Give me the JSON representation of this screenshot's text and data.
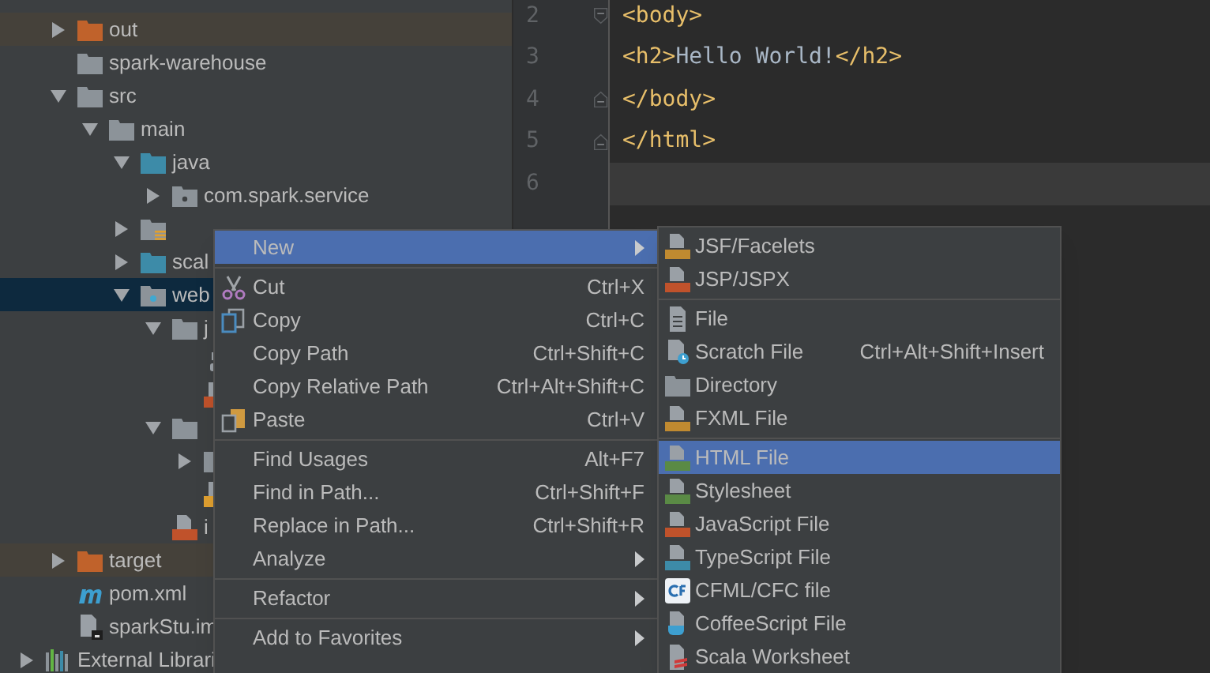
{
  "project_tree": [
    {
      "name": "out",
      "kind": "folder-excluded",
      "expanded": false,
      "selected": false
    },
    {
      "name": "spark-warehouse",
      "kind": "folder",
      "selected": false
    },
    {
      "name": "src",
      "kind": "folder",
      "expanded": true,
      "selected": false,
      "children": [
        {
          "name": "main",
          "kind": "folder",
          "expanded": true,
          "selected": false,
          "children": [
            {
              "name": "java",
              "kind": "folder-source",
              "expanded": true,
              "selected": false,
              "children": [
                {
                  "name": "com.spark.service",
                  "kind": "package",
                  "expanded": false,
                  "selected": false
                }
              ]
            },
            {
              "kind": "folder-resources",
              "expanded": false,
              "selected": false
            },
            {
              "name": "scal",
              "kind": "folder-source",
              "expanded": false,
              "selected": false
            },
            {
              "name": "web",
              "kind": "folder-web",
              "expanded": true,
              "selected": true,
              "children": [
                {
                  "name": "j",
                  "kind": "folder",
                  "expanded": true,
                  "selected": false,
                  "children": [
                    {
                      "kind": "file-binary",
                      "selected": false
                    },
                    {
                      "kind": "file-jsp",
                      "selected": false
                    }
                  ]
                },
                {
                  "kind": "folder",
                  "expanded": true,
                  "selected": false,
                  "children": [
                    {
                      "kind": "folder",
                      "expanded": false,
                      "selected": false
                    },
                    {
                      "kind": "file-xml",
                      "selected": false
                    }
                  ]
                },
                {
                  "name": "i",
                  "kind": "file-jsp",
                  "selected": false
                }
              ]
            }
          ]
        }
      ]
    },
    {
      "name": "target",
      "kind": "folder-excluded",
      "expanded": false,
      "selected": false
    },
    {
      "name": "pom.xml",
      "kind": "file-maven",
      "selected": false
    },
    {
      "name": "sparkStu.im",
      "kind": "file-iml",
      "selected": false
    }
  ],
  "external_libraries": {
    "name": "External Librari",
    "kind": "libraries",
    "expanded": false,
    "selected": false
  },
  "editor": {
    "lines": [
      {
        "number": "2",
        "current": false,
        "tokens": [
          {
            "kind": "tag",
            "text": "<body>"
          }
        ]
      },
      {
        "number": "3",
        "current": false,
        "tokens": [
          {
            "kind": "tag",
            "text": "<h2>"
          },
          {
            "kind": "text",
            "text": "Hello World!"
          },
          {
            "kind": "tag",
            "text": "</h2>"
          }
        ]
      },
      {
        "number": "4",
        "current": false,
        "tokens": [
          {
            "kind": "tag",
            "text": "</body>"
          }
        ]
      },
      {
        "number": "5",
        "current": false,
        "tokens": [
          {
            "kind": "tag",
            "text": "</html>"
          }
        ]
      },
      {
        "number": "6",
        "current": true
      }
    ]
  },
  "context_menu": [
    {
      "kind": "item",
      "label": "New",
      "submenu": true,
      "selected": true
    },
    {
      "kind": "separator"
    },
    {
      "kind": "item",
      "label": "Cut",
      "shortcut": "Ctrl+X",
      "submenu": false,
      "selected": false
    },
    {
      "kind": "item",
      "label": "Copy",
      "shortcut": "Ctrl+C",
      "submenu": false,
      "selected": false
    },
    {
      "kind": "item",
      "label": "Copy Path",
      "shortcut": "Ctrl+Shift+C",
      "submenu": false,
      "selected": false
    },
    {
      "kind": "item",
      "label": "Copy Relative Path",
      "shortcut": "Ctrl+Alt+Shift+C",
      "submenu": false,
      "selected": false
    },
    {
      "kind": "item",
      "label": "Paste",
      "shortcut": "Ctrl+V",
      "submenu": false,
      "selected": false
    },
    {
      "kind": "separator"
    },
    {
      "kind": "item",
      "label": "Find Usages",
      "shortcut": "Alt+F7",
      "submenu": false,
      "selected": false
    },
    {
      "kind": "item",
      "label": "Find in Path...",
      "shortcut": "Ctrl+Shift+F",
      "submenu": false,
      "selected": false
    },
    {
      "kind": "item",
      "label": "Replace in Path...",
      "shortcut": "Ctrl+Shift+R",
      "submenu": false,
      "selected": false
    },
    {
      "kind": "item",
      "label": "Analyze",
      "submenu": true,
      "selected": false
    },
    {
      "kind": "separator"
    },
    {
      "kind": "item",
      "label": "Refactor",
      "submenu": true,
      "selected": false
    },
    {
      "kind": "separator"
    },
    {
      "kind": "item",
      "label": "Add to Favorites",
      "submenu": true,
      "selected": false
    }
  ],
  "submenu": [
    {
      "kind": "item",
      "label": "JSF/Facelets",
      "selected": false
    },
    {
      "kind": "item",
      "label": "JSP/JSPX",
      "selected": false
    },
    {
      "kind": "separator"
    },
    {
      "kind": "item",
      "label": "File",
      "selected": false
    },
    {
      "kind": "item",
      "label": "Scratch File",
      "shortcut": "Ctrl+Alt+Shift+Insert",
      "selected": false
    },
    {
      "kind": "item",
      "label": "Directory",
      "selected": false
    },
    {
      "kind": "item",
      "label": "FXML File",
      "selected": false
    },
    {
      "kind": "separator"
    },
    {
      "kind": "item",
      "label": "HTML File",
      "selected": true
    },
    {
      "kind": "item",
      "label": "Stylesheet",
      "selected": false
    },
    {
      "kind": "item",
      "label": "JavaScript File",
      "selected": false
    },
    {
      "kind": "item",
      "label": "TypeScript File",
      "selected": false
    },
    {
      "kind": "item",
      "label": "CFML/CFC file",
      "selected": false
    },
    {
      "kind": "item",
      "label": "CoffeeScript File",
      "selected": false
    },
    {
      "kind": "item",
      "label": "Scala Worksheet",
      "selected": false
    }
  ]
}
